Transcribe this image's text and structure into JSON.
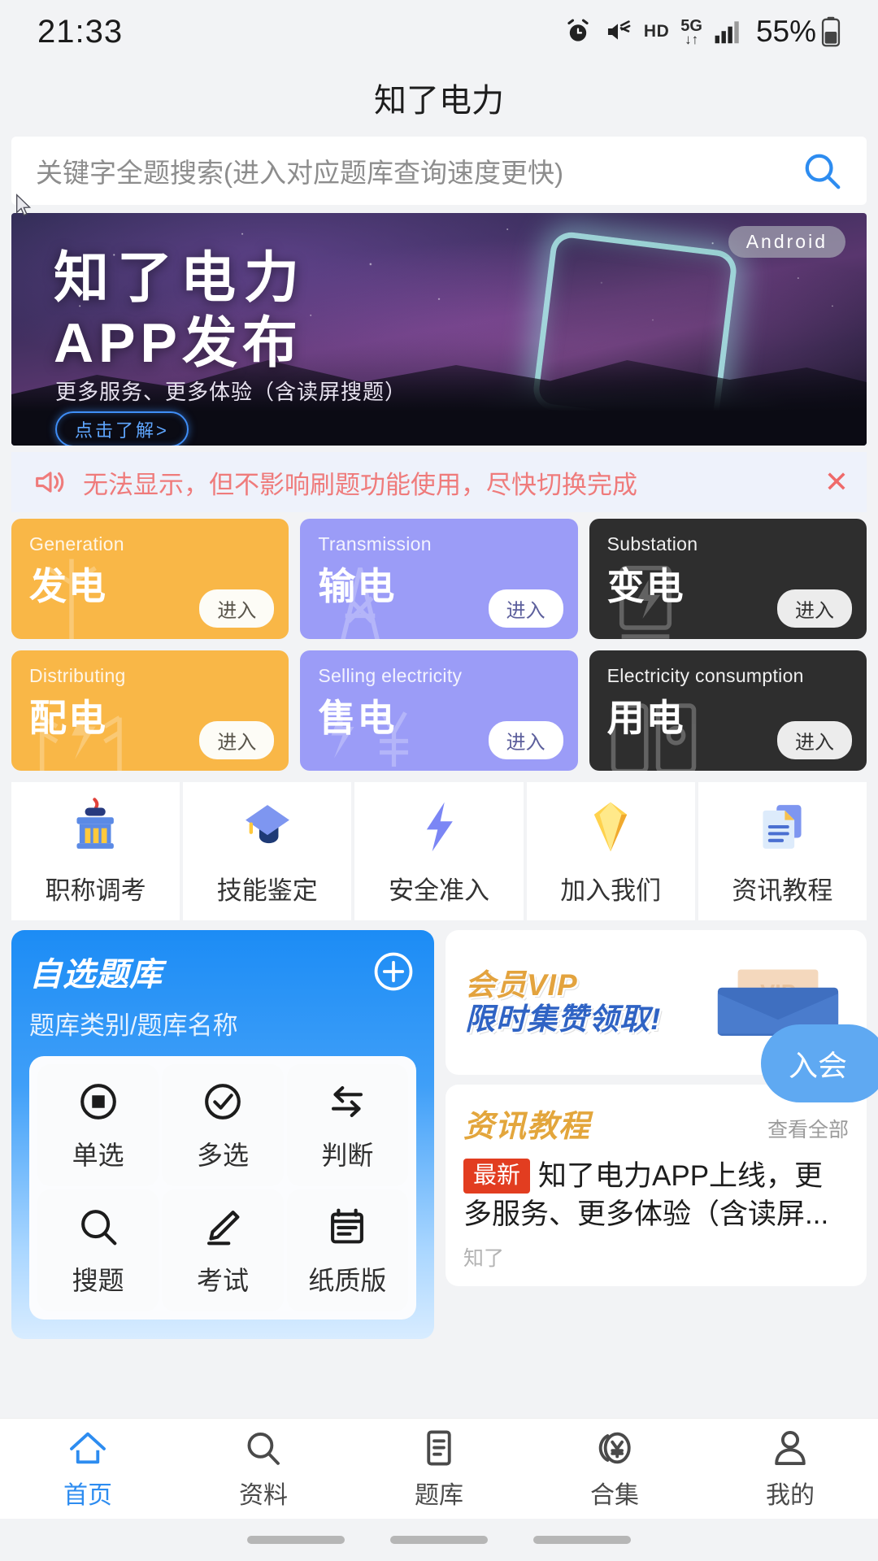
{
  "status_bar": {
    "time": "21:33",
    "hd_label": "HD",
    "network_label": "5G",
    "network_arrows": "↓↑",
    "battery_text": "55%",
    "icons": [
      "alarm-icon",
      "mute-icon",
      "hd-icon",
      "5g-icon",
      "signal-icon",
      "battery-icon"
    ]
  },
  "header": {
    "title": "知了电力"
  },
  "search": {
    "placeholder": "关键字全题搜索(进入对应题库查询速度更快)",
    "icon": "search-icon",
    "accent": "#2d8cf0"
  },
  "banner": {
    "badge": "Android",
    "title_line1": "知了电力",
    "title_line2": "APP发布",
    "subtitle": "更多服务、更多体验（含读屏搜题）",
    "button": "点击了解>"
  },
  "notice": {
    "text": "无法显示，但不影响刷题功能使用，尽快切换完成",
    "speaker_icon": "speaker-icon",
    "close_icon": "close-icon",
    "color": "#ef7b7b",
    "background": "#eef2fb"
  },
  "categories": [
    {
      "en": "Generation",
      "cn": "发电",
      "enter": "进入",
      "theme": "orange",
      "color": "#f9b747"
    },
    {
      "en": "Transmission",
      "cn": "输电",
      "enter": "进入",
      "theme": "purple",
      "color": "#9b9cf7"
    },
    {
      "en": "Substation",
      "cn": "变电",
      "enter": "进入",
      "theme": "dark",
      "color": "#2e2e2e"
    },
    {
      "en": "Distributing",
      "cn": "配电",
      "enter": "进入",
      "theme": "orange",
      "color": "#f9b747"
    },
    {
      "en": "Selling electricity",
      "cn": "售电",
      "enter": "进入",
      "theme": "purple",
      "color": "#9b9cf7"
    },
    {
      "en": "Electricity consumption",
      "cn": "用电",
      "enter": "进入",
      "theme": "dark",
      "color": "#2e2e2e"
    }
  ],
  "quick_links": [
    {
      "label": "职称调考",
      "icon": "building-icon"
    },
    {
      "label": "技能鉴定",
      "icon": "graduation-cap-icon"
    },
    {
      "label": "安全准入",
      "icon": "lightning-icon"
    },
    {
      "label": "加入我们",
      "icon": "diamond-icon"
    },
    {
      "label": "资讯教程",
      "icon": "document-icon"
    }
  ],
  "question_bank": {
    "title": "自选题库",
    "subtitle": "题库类别/题库名称",
    "add_icon": "plus-circle-icon",
    "items": [
      {
        "label": "单选",
        "icon": "radio-filled-icon"
      },
      {
        "label": "多选",
        "icon": "check-circle-icon"
      },
      {
        "label": "判断",
        "icon": "arrows-lr-icon"
      },
      {
        "label": "搜题",
        "icon": "search-icon"
      },
      {
        "label": "考试",
        "icon": "pencil-icon"
      },
      {
        "label": "纸质版",
        "icon": "clipboard-icon"
      }
    ]
  },
  "vip_card": {
    "line1_prefix": "会员",
    "line1_vip": "VIP",
    "line2": "限时集赞领取!",
    "join_button": "入会",
    "envelope_icon": "envelope-icon"
  },
  "news": {
    "title": "资讯教程",
    "view_all": "查看全部",
    "badge": "最新",
    "headline": "知了电力APP上线，更多服务、更多体验（含读屏...",
    "author": "知了"
  },
  "tabbar": [
    {
      "label": "首页",
      "icon": "home-icon",
      "active": true
    },
    {
      "label": "资料",
      "icon": "search-icon",
      "active": false
    },
    {
      "label": "题库",
      "icon": "book-icon",
      "active": false
    },
    {
      "label": "合集",
      "icon": "yen-coin-icon",
      "active": false
    },
    {
      "label": "我的",
      "icon": "person-icon",
      "active": false
    }
  ]
}
